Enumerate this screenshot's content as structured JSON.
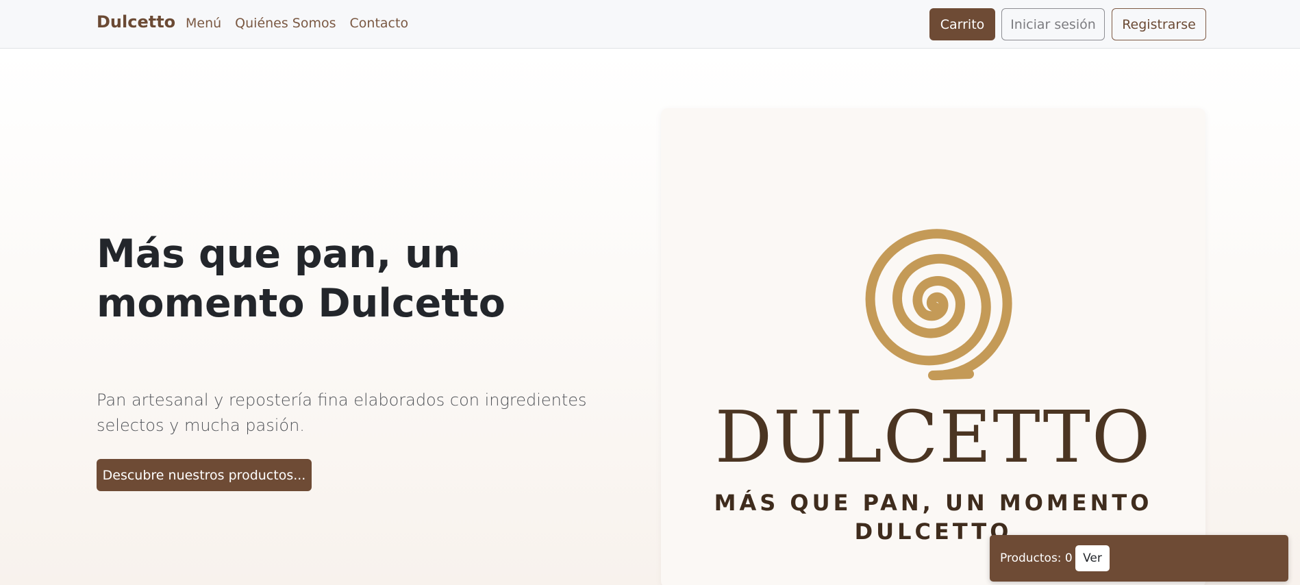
{
  "navbar": {
    "brand": "Dulcetto",
    "links": [
      "Menú",
      "Quiénes Somos",
      "Contacto"
    ],
    "cart_button": "Carrito",
    "login_button": "Iniciar sesión",
    "register_button": "Registrarse"
  },
  "hero": {
    "title": "Más que pan, un momento Dulcetto",
    "subtitle": "Pan artesanal y repostería fina elaborados con ingredientes selectos y mucha pasión.",
    "cta": "Descubre nuestros productos..."
  },
  "logo": {
    "wordmark": "DULCETTO",
    "tagline": "MÁS QUE PAN, UN MOMENTO DULCETTO"
  },
  "cart_widget": {
    "count_label": "Productos: 0",
    "view_button": "Ver"
  },
  "colors": {
    "brand_brown": "#6e4b35",
    "spiral_gold": "#c49a57",
    "logo_text": "#4b3522"
  }
}
